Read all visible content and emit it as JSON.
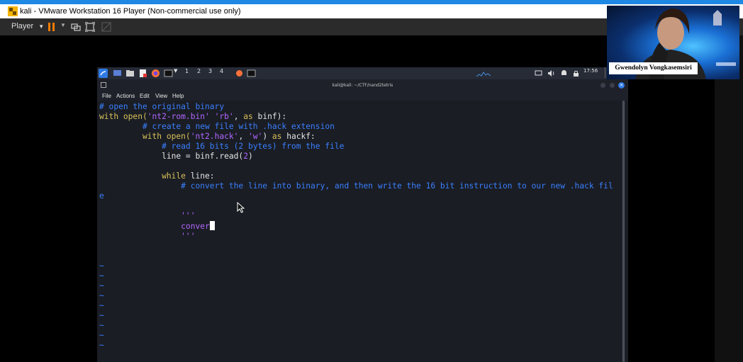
{
  "vmware": {
    "title": "kali - VMware Workstation 16 Player (Non-commercial use only)",
    "toolbar": {
      "player_label": "Player"
    }
  },
  "kali_panel": {
    "workspaces": [
      "1",
      "2",
      "3",
      "4"
    ],
    "clock": "17:56"
  },
  "terminal": {
    "title": "kali@kali: ~/CTF/nand2tetris",
    "menu": [
      "File",
      "Actions",
      "Edit",
      "View",
      "Help"
    ],
    "code": {
      "l1": "# open the original binary",
      "l2_kw1": "with",
      "l2_fn": "open(",
      "l2_s1": "'nt2-rom.bin'",
      "l2_s2": "'rb'",
      "l2_as": "as",
      "l2_rest": " binf):",
      "l3": "# create a new file with .hack extension",
      "l4_kw": "with",
      "l4_fn": "open(",
      "l4_s1": "'nt2.hack'",
      "l4_s2": "'w'",
      "l4_as": "as",
      "l4_rest": " hackf:",
      "l5": "# read 16 bits (2 bytes) from the file",
      "l6_a": "line = binf.read(",
      "l6_n": "2",
      "l6_b": ")",
      "l8_kw": "while",
      "l8_rest": " line:",
      "l9": "# convert the line into binary, and then write the 16 bit instruction to our new .hack fil",
      "l10": "e",
      "l12": "'''",
      "l13": "conver",
      "l14": "'''",
      "tilde": "~"
    }
  },
  "webcam": {
    "name": "Gwendolyn Vongkasemsiri"
  }
}
